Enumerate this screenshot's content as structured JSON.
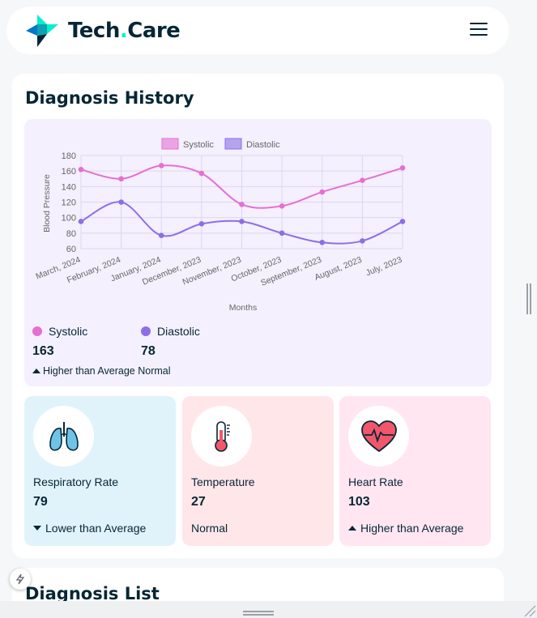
{
  "header": {
    "brand_prefix": "Tech",
    "brand_dot": ".",
    "brand_suffix": "Care"
  },
  "diagnosis_history": {
    "title": "Diagnosis History",
    "chart_data": {
      "type": "line",
      "categories": [
        "March, 2024",
        "February, 2024",
        "January, 2024",
        "December, 2023",
        "November, 2023",
        "October, 2023",
        "September, 2023",
        "August, 2023",
        "July, 2023"
      ],
      "series": [
        {
          "name": "Systolic",
          "color": "#e66fd2",
          "values": [
            162,
            150,
            167,
            157,
            117,
            115,
            133,
            148,
            164
          ]
        },
        {
          "name": "Diastolic",
          "color": "#8c6fe6",
          "values": [
            95,
            120,
            77,
            92,
            95,
            80,
            68,
            70,
            95
          ]
        }
      ],
      "xlabel": "Months",
      "ylabel": "Blood Pressure",
      "ylim": [
        60,
        180
      ],
      "yticks": [
        "180",
        "160",
        "140",
        "120",
        "100",
        "80",
        "60"
      ],
      "legend_position": "top",
      "grid": true
    },
    "systolic": {
      "label": "Systolic",
      "value": "163",
      "color": "#e66fd2"
    },
    "diastolic": {
      "label": "Diastolic",
      "value": "78",
      "color": "#8c6fe6"
    },
    "note": "Higher than Average Normal"
  },
  "vitals": [
    {
      "label": "Respiratory Rate",
      "value": "79",
      "status": "Lower than Average",
      "bg": "#e0f3fa",
      "icon": "lungs-icon"
    },
    {
      "label": "Temperature",
      "value": "27",
      "status": "Normal",
      "bg": "#ffe6e9",
      "icon": "thermometer-icon"
    },
    {
      "label": "Heart Rate",
      "value": "103",
      "status": "Higher than Average",
      "bg": "#ffe6f1",
      "icon": "heart-icon"
    }
  ],
  "diagnosis_list": {
    "title": "Diagnosis List"
  }
}
